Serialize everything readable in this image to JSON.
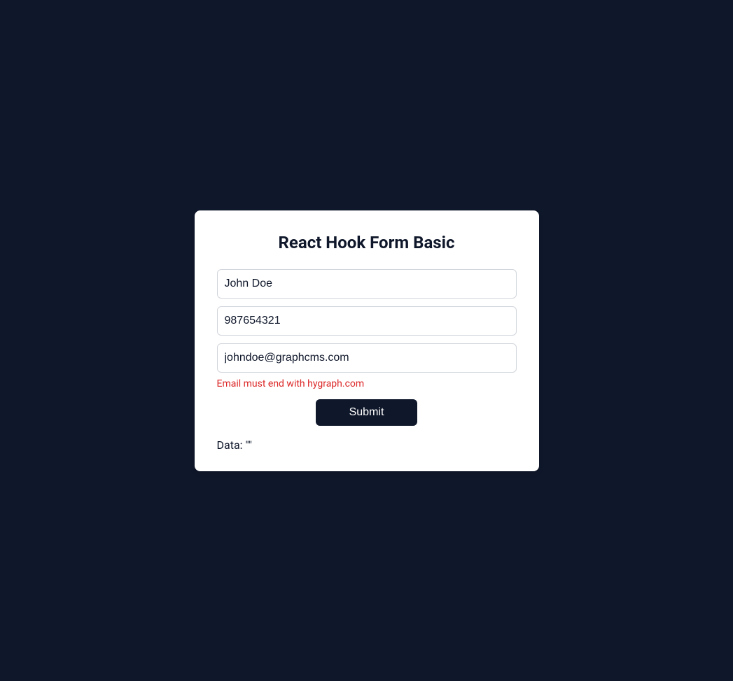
{
  "form": {
    "title": "React Hook Form Basic",
    "fields": {
      "name": {
        "value": "John Doe"
      },
      "phone": {
        "value": "987654321"
      },
      "email": {
        "value": "johndoe@graphcms.com"
      }
    },
    "error": "Email must end with hygraph.com",
    "submit_label": "Submit",
    "data_output": "Data: \"\""
  }
}
